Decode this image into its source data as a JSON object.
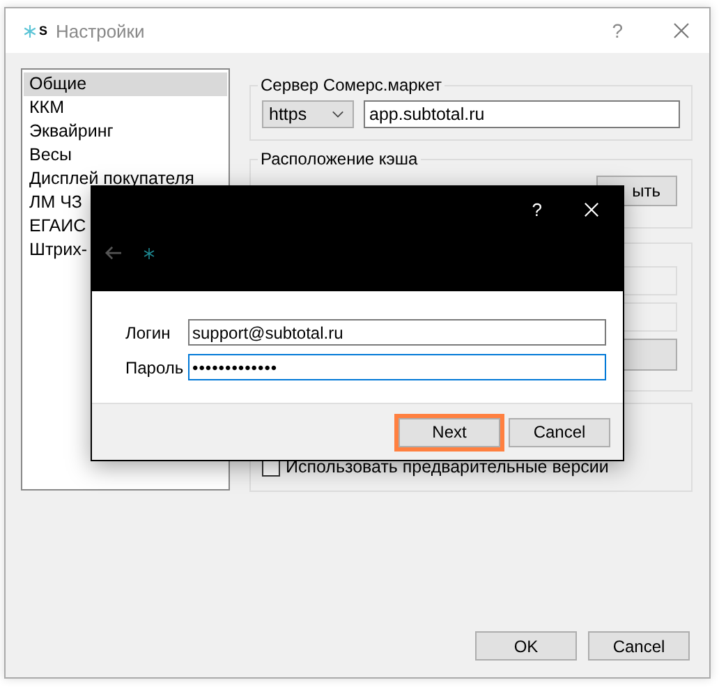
{
  "window": {
    "logo": "S",
    "title": "Настройки",
    "help": "?"
  },
  "sidebar": {
    "items": [
      {
        "label": "Общие",
        "selected": true
      },
      {
        "label": "ККМ",
        "selected": false
      },
      {
        "label": "Эквайринг",
        "selected": false
      },
      {
        "label": "Весы",
        "selected": false
      },
      {
        "label": "Дисплей покупателя",
        "selected": false
      },
      {
        "label": "ЛМ ЧЗ",
        "selected": false
      },
      {
        "label": "ЕГАИС",
        "selected": false
      },
      {
        "label": "Штрих-",
        "selected": false
      }
    ]
  },
  "server_group": {
    "title": "Сервер Сомерс.маркет",
    "protocol": "https",
    "address": "app.subtotal.ru"
  },
  "cache_group": {
    "title": "Расположение кэша",
    "button": "ыть"
  },
  "updates_group": {
    "checkbox": {
      "label": "Использовать предварительные версии",
      "checked": false
    }
  },
  "dialog": {
    "help": "?",
    "login": {
      "label": "Логин",
      "value": "support@subtotal.ru"
    },
    "password": {
      "label": "Пароль",
      "value": "•••••••••••••"
    },
    "buttons": [
      {
        "label": "Next",
        "focused": true
      },
      {
        "label": "Cancel",
        "focused": false
      }
    ]
  },
  "buttons": [
    "OK",
    "Cancel"
  ]
}
